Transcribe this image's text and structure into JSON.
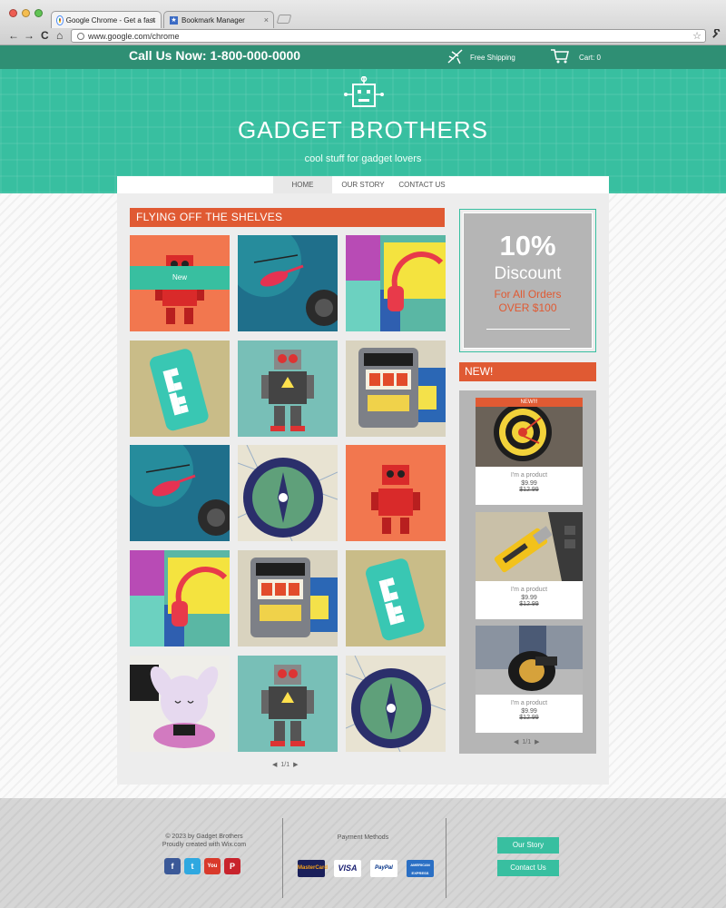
{
  "browser": {
    "tabs": [
      {
        "title": "Google Chrome - Get a fast",
        "close": "×"
      },
      {
        "title": "Bookmark Manager",
        "close": "×"
      }
    ],
    "back": "←",
    "forward": "→",
    "reload": "C",
    "home": "⌂",
    "url": "www.google.com/chrome",
    "star": "☆",
    "wrench": "🔧"
  },
  "topbar": {
    "phone": "Call Us Now: 1-800-000-0000",
    "shipping": "Free Shipping",
    "cart": "Cart: 0"
  },
  "hero": {
    "brand": "GADGET BROTHERS",
    "tagline": "cool stuff for gadget lovers"
  },
  "nav": {
    "items": [
      "HOME",
      "OUR STORY",
      "CONTACT US"
    ]
  },
  "shelf": {
    "title": "FLYING OFF THE SHELVES",
    "new_badge": "New",
    "tiles": [
      "red-robot",
      "helicopter",
      "headphones",
      "phone-case",
      "tin-robot",
      "slot-machine",
      "helicopter",
      "compass",
      "red-robot",
      "headphones",
      "slot-machine",
      "phone-case",
      "bunny-figurine",
      "tin-robot",
      "compass"
    ],
    "pager": {
      "prev": "◀",
      "page": "1/1",
      "next": "▶"
    }
  },
  "promo": {
    "percent": "10%",
    "word": "Discount",
    "line1": "For All Orders",
    "line2": "OVER $100"
  },
  "new_section": {
    "title": "NEW!",
    "products": [
      {
        "ribbon": "NEW!!!",
        "name": "I'm a product",
        "price": "$9.99",
        "old_price": "$12.99",
        "image": "dartboard"
      },
      {
        "ribbon": "",
        "name": "I'm a product",
        "price": "$9.99",
        "old_price": "$12.99",
        "image": "usb-stick"
      },
      {
        "ribbon": "",
        "name": "I'm a product",
        "price": "$9.99",
        "old_price": "$12.99",
        "image": "unicycle"
      }
    ],
    "pager": {
      "prev": "◀",
      "page": "1/1",
      "next": "▶"
    }
  },
  "footer": {
    "copyright": "© 2023 by Gadget Brothers",
    "credit": "Proudly created with Wix.com",
    "social": [
      "f",
      "t",
      "You",
      "P"
    ],
    "payment_title": "Payment Methods",
    "payment_cards": [
      "MasterCard",
      "VISA",
      "PayPal",
      "AMERICAN EXPRESS"
    ],
    "buttons": [
      "Our Story",
      "Contact Us"
    ]
  },
  "colors": {
    "teal": "#38bfa0",
    "dark_teal": "#2f8f74",
    "orange": "#e05a33",
    "gray_panel": "#b5b5b5"
  }
}
